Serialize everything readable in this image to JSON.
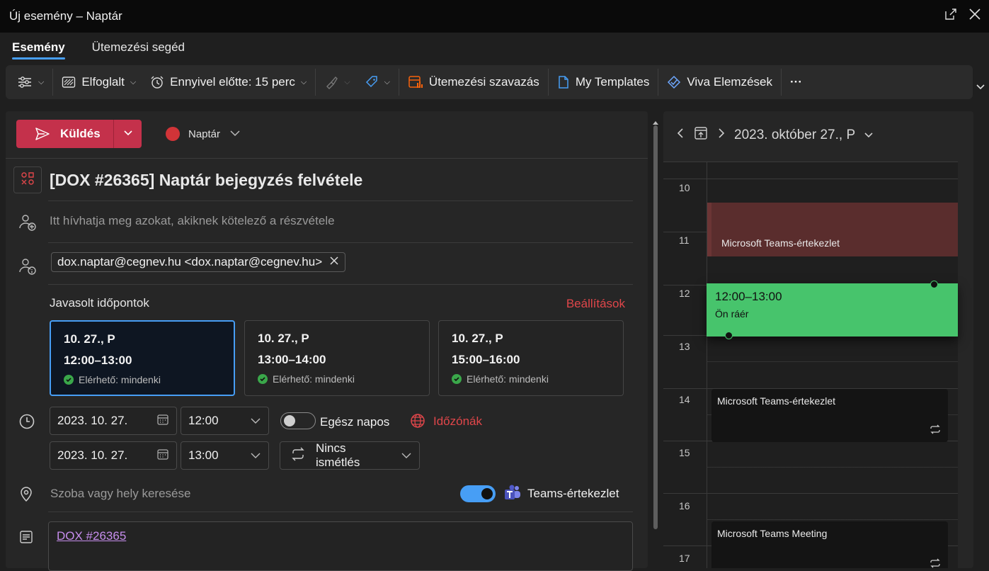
{
  "window": {
    "title": "Új esemény – Naptár"
  },
  "tabs": [
    {
      "label": "Esemény",
      "active": true
    },
    {
      "label": "Ütemezési segéd",
      "active": false
    }
  ],
  "toolbar": {
    "status": "Elfoglalt",
    "reminder": "Ennyivel előtte: 15 perc",
    "poll": "Ütemezési szavazás",
    "templates": "My Templates",
    "viva": "Viva Elemzések",
    "more": "···"
  },
  "compose": {
    "send_label": "Küldés",
    "calendar_name": "Naptár",
    "calendar_color": "#d13438",
    "subject": "[DOX #26365] Naptár bejegyzés felvétele",
    "required_placeholder": "Itt hívhatja meg azokat, akiknek kötelező a részvétele",
    "attendee": "dox.naptar@cegnev.hu <dox.naptar@cegnev.hu>",
    "suggested_title": "Javasolt időpontok",
    "settings_link": "Beállítások",
    "suggestions": [
      {
        "date": "10. 27., P",
        "time": "12:00–13:00",
        "availability": "Elérhető: mindenki",
        "selected": true
      },
      {
        "date": "10. 27., P",
        "time": "13:00–14:00",
        "availability": "Elérhető: mindenki",
        "selected": false
      },
      {
        "date": "10. 27., P",
        "time": "15:00–16:00",
        "availability": "Elérhető: mindenki",
        "selected": false
      }
    ],
    "start_date": "2023. 10. 27.",
    "start_time": "12:00",
    "end_date": "2023. 10. 27.",
    "end_time": "13:00",
    "all_day_label": "Egész napos",
    "all_day_on": false,
    "timezone_label": "Időzónák",
    "recurrence": "Nincs ismétlés",
    "location_placeholder": "Szoba vagy hely keresése",
    "teams_label": "Teams-értekezlet",
    "teams_on": true,
    "body_link": "DOX #26365"
  },
  "calendar": {
    "date_label": "2023. október 27., P",
    "hours": [
      "10",
      "11",
      "12",
      "13",
      "14",
      "15",
      "16",
      "17"
    ],
    "events": [
      {
        "title": "Microsoft Teams-értekezlet"
      },
      {
        "time": "12:00–13:00",
        "status": "Ön ráér"
      },
      {
        "title": "Microsoft Teams-értekezlet"
      },
      {
        "title": "Microsoft Teams Meeting"
      }
    ]
  }
}
